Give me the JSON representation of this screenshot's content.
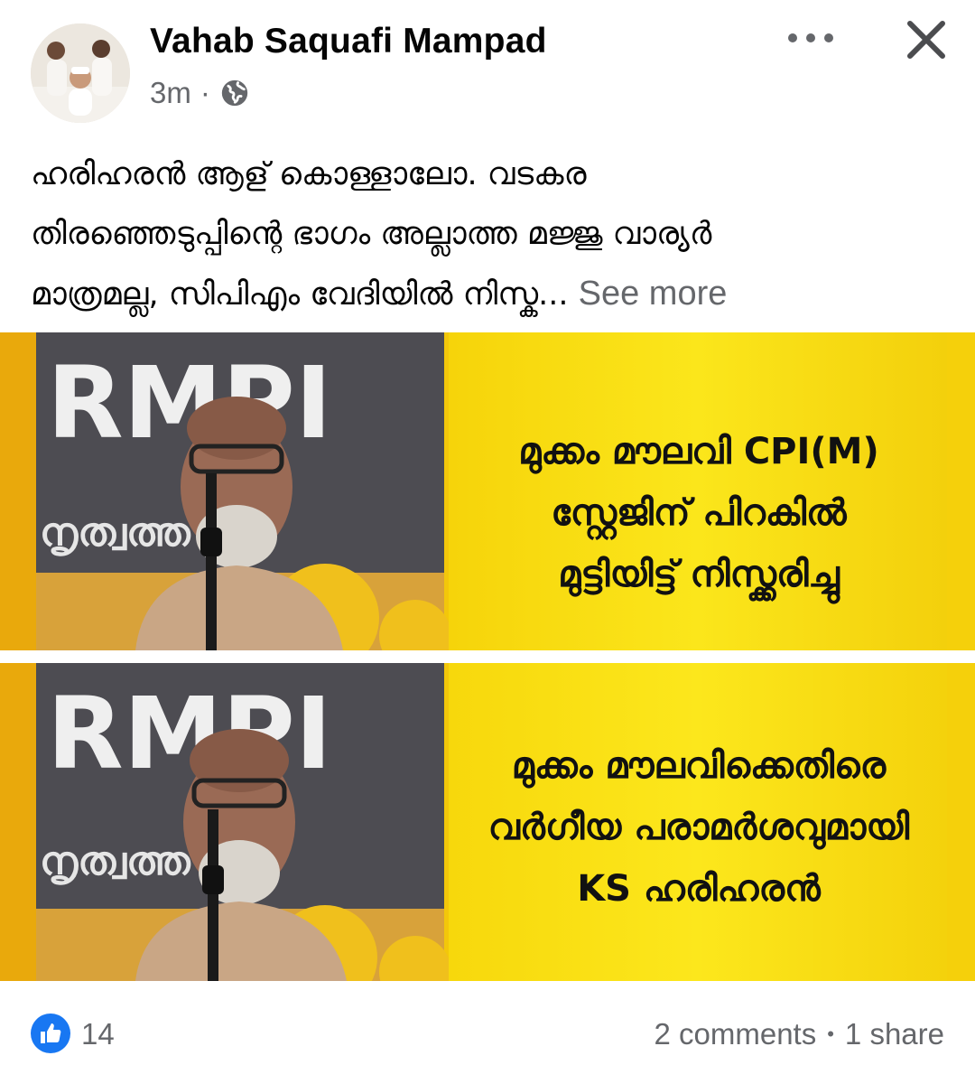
{
  "post": {
    "author": "Vahab Saquafi Mampad",
    "timestamp": "3m",
    "separator": "·",
    "audience_icon": "globe-icon",
    "text_lines": [
      "ഹരിഹരൻ ആള് കൊള്ളാലോ.  വടകര",
      "തിരഞ്ഞെടുപ്പിന്റെ ഭാഗം അല്ലാത്ത മജ്ജു വാര്യർ",
      "മാത്രമല്ല, സിപിഎം വേദിയിൽ നിസ്ക..."
    ],
    "see_more": "See more"
  },
  "media": {
    "frame1": {
      "banner_text": "RMPI",
      "side_text": "നൃത്വത്ത",
      "caption": [
        "മുക്കം മൗലവി CPI(M)",
        "സ്റ്റേജിന് പിറകിൽ",
        "മുട്ടിയിട്ട് നിസ്ക്കരിച്ചു"
      ]
    },
    "frame2": {
      "banner_text": "RMPI",
      "side_text": "നൃത്വത്ത",
      "caption": [
        "മുക്കം മൗലവിക്കെതിരെ",
        "വർഗീയ പരാമർശവുമായി",
        "KS ഹരിഹരൻ"
      ]
    }
  },
  "footer": {
    "like_icon": "like-icon",
    "like_count": "14",
    "comments": "2 comments",
    "stats_separator": "•",
    "shares": "1 share"
  },
  "colors": {
    "facebook_blue": "#1877f2",
    "caption_yellow": "#f8de12",
    "secondary_text": "#65676b"
  }
}
